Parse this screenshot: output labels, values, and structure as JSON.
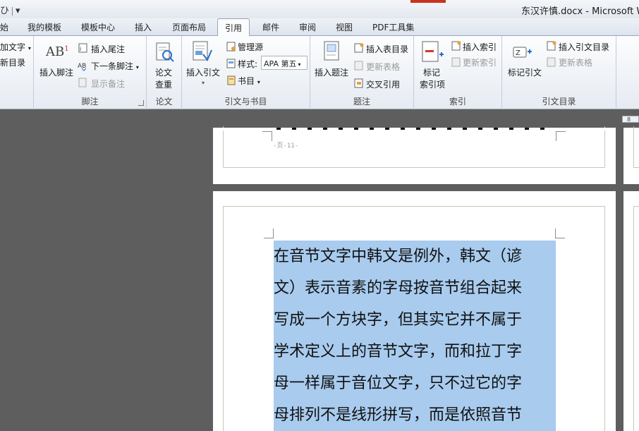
{
  "app": {
    "window_title": "东汉许慎.docx - Microsoft W",
    "qat_left": "ひ",
    "qat_more": "▾"
  },
  "tabs": [
    {
      "label": "始"
    },
    {
      "label": "我的模板"
    },
    {
      "label": "模板中心"
    },
    {
      "label": "插入"
    },
    {
      "label": "页面布局"
    },
    {
      "label": "引用"
    },
    {
      "label": "邮件"
    },
    {
      "label": "审阅"
    },
    {
      "label": "视图"
    },
    {
      "label": "PDF工具集"
    }
  ],
  "ribbon": {
    "toc": {
      "add_text": "加文字",
      "update_toc": "新目录"
    },
    "footnote": {
      "group_label": "脚注",
      "insert_footnote": "插入脚注",
      "insert_endnote": "插入尾注",
      "next_footnote": "下一条脚注",
      "show_notes": "显示备注",
      "ab_glyph": "AB",
      "ab_sup": "1"
    },
    "paper": {
      "group_label": "论文",
      "check_line1": "论文",
      "check_line2": "查重"
    },
    "citations": {
      "group_label": "引文与书目",
      "insert_citation": "插入引文",
      "manage_sources": "管理源",
      "style_label": "样式:",
      "style_value": "APA 第五",
      "bibliography": "书目"
    },
    "captions": {
      "group_label": "题注",
      "insert_caption": "插入题注",
      "insert_table_of_figures": "插入表目录",
      "update_table": "更新表格",
      "cross_reference": "交叉引用"
    },
    "index": {
      "group_label": "索引",
      "mark_entry_line1": "标记",
      "mark_entry_line2": "索引项",
      "insert_index": "插入索引",
      "update_index": "更新索引"
    },
    "toa": {
      "group_label": "引文目录",
      "mark_citation": "标记引文",
      "insert_toa": "插入引文目录",
      "update_table": "更新表格"
    }
  },
  "document": {
    "ruler_tab": "8",
    "page_number_text": "-页-11-",
    "paragraph_lines": [
      "在音节文字中韩文是例外，韩文（谚",
      "文）表示音素的字母按音节组合起来",
      "写成一个方块字，但其实它并不属于",
      "学术定义上的音节文字，而和拉丁字",
      "母一样属于音位文字，只不过它的字",
      "母排列不是线形拼写，而是依照音节"
    ],
    "selection_color": "#a8cbee"
  }
}
